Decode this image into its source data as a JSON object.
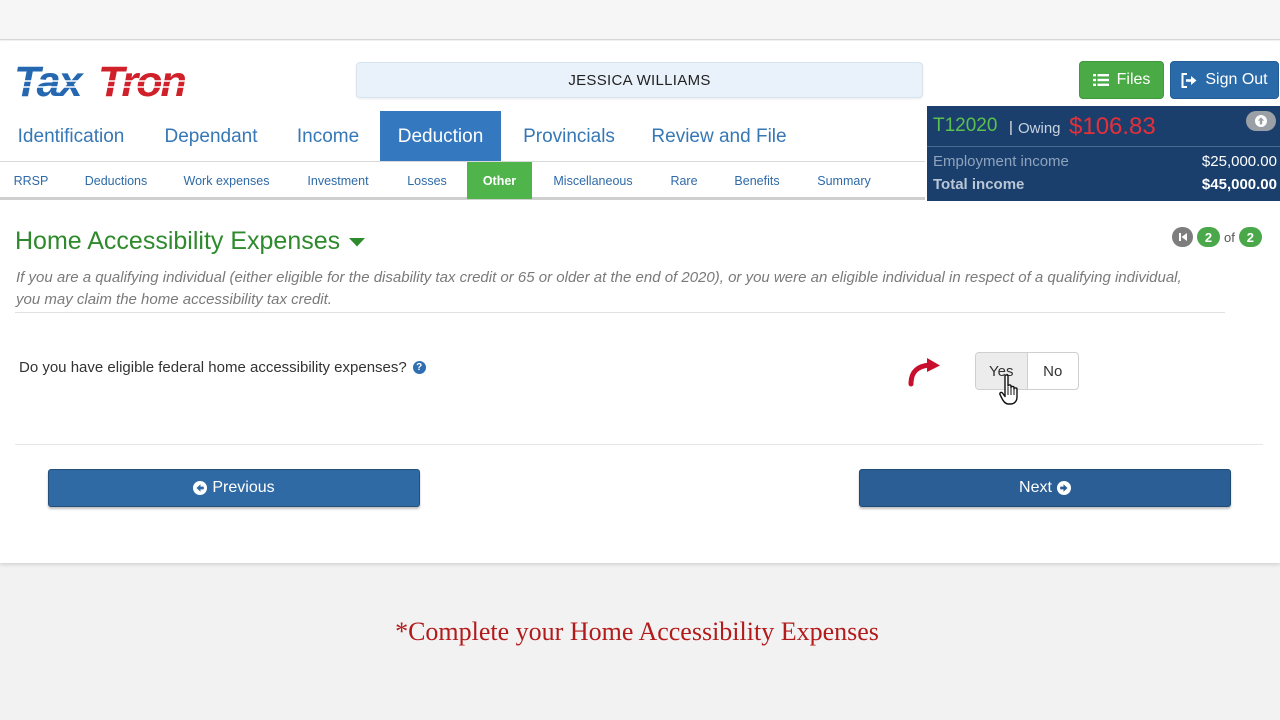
{
  "header": {
    "logo_text": "TaxTron",
    "client_name": "JESSICA WILLIAMS",
    "files_label": "Files",
    "signout_label": "Sign Out"
  },
  "main_nav": [
    {
      "label": "Identification",
      "active": false
    },
    {
      "label": "Dependant",
      "active": false
    },
    {
      "label": "Income",
      "active": false
    },
    {
      "label": "Deduction",
      "active": true
    },
    {
      "label": "Provincials",
      "active": false
    },
    {
      "label": "Review and File",
      "active": false
    }
  ],
  "sub_nav": [
    {
      "label": "RRSP",
      "active": false
    },
    {
      "label": "Deductions",
      "active": false
    },
    {
      "label": "Work expenses",
      "active": false
    },
    {
      "label": "Investment",
      "active": false
    },
    {
      "label": "Losses",
      "active": false
    },
    {
      "label": "Other",
      "active": true
    },
    {
      "label": "Miscellaneous",
      "active": false
    },
    {
      "label": "Rare",
      "active": false
    },
    {
      "label": "Benefits",
      "active": false
    },
    {
      "label": "Summary",
      "active": false
    }
  ],
  "summary": {
    "form_code": "T12020",
    "separator": "|",
    "owing_label": "Owing",
    "owing_value": "$106.83",
    "employment_label": "Employment income",
    "employment_value": "$25,000.00",
    "total_label": "Total income",
    "total_value": "$45,000.00"
  },
  "page": {
    "title": "Home Accessibility Expenses",
    "current_page": "2",
    "of_label": "of",
    "total_pages": "2",
    "intro": "If you are a qualifying individual (either eligible for the disability tax credit or 65 or older at the end of 2020), or you were an eligible individual in respect of a qualifying individual, you may claim the home accessibility tax credit.",
    "question": "Do you have eligible federal home accessibility expenses?",
    "yes_label": "Yes",
    "no_label": "No",
    "previous_label": "Previous",
    "next_label": "Next"
  },
  "caption": "*Complete your Home Accessibility Expenses",
  "colors": {
    "brand_blue": "#3478c0",
    "brand_red": "#d0202a",
    "green": "#4aaa46",
    "summary_bg": "#1a3f6c",
    "owing": "#e3303a"
  },
  "icons": {
    "files": "list-icon",
    "signout": "sign-out-icon",
    "title_toggle": "caret-down-icon",
    "help": "question-circle-icon",
    "previous": "arrow-circle-left-icon",
    "next": "arrow-circle-right-icon",
    "first": "step-backward-icon",
    "collapse": "arrow-up-icon",
    "pointer": "hand-pointer-icon",
    "annotation": "curved-arrow-icon"
  }
}
